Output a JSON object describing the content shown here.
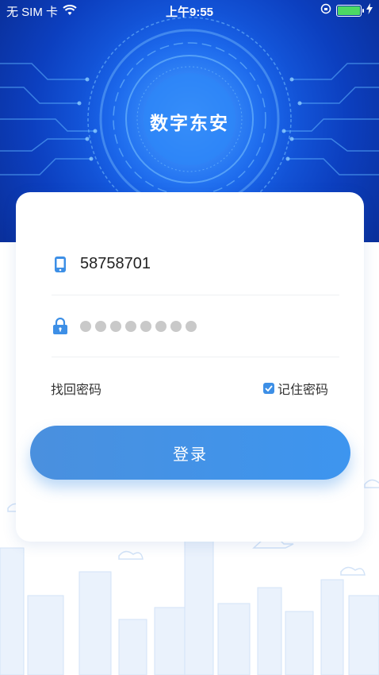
{
  "status_bar": {
    "carrier": "无 SIM 卡",
    "time": "上午9:55"
  },
  "app": {
    "title": "数字东安"
  },
  "login": {
    "phone_value": "58758701",
    "password_mask_count": 8,
    "forgot_password_label": "找回密码",
    "remember_password_label": "记住密码",
    "remember_checked": true,
    "submit_label": "登录"
  },
  "colors": {
    "accent": "#3d8fe6",
    "hero_blue": "#1760e6",
    "battery_green": "#4cd964"
  },
  "icons": [
    "wifi-icon",
    "rotation-lock-icon",
    "battery-icon",
    "charging-icon",
    "phone-icon",
    "lock-icon",
    "checkbox-checked-icon"
  ]
}
